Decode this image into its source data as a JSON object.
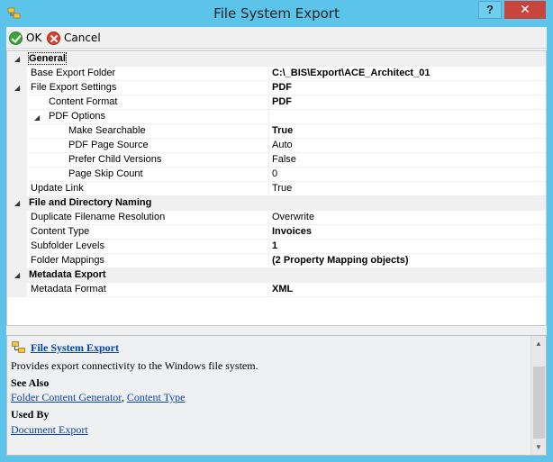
{
  "window": {
    "title": "File System Export",
    "help_button": "?",
    "close_button": "✕"
  },
  "toolbar": {
    "ok_label": "OK",
    "cancel_label": "Cancel"
  },
  "grid": {
    "general": {
      "label": "General",
      "base_export_folder": {
        "name": "Base Export Folder",
        "value": "C:\\_BIS\\Export\\ACE_Architect_01"
      },
      "file_export_settings": {
        "name": "File Export Settings",
        "value": "PDF"
      },
      "content_format": {
        "name": "Content Format",
        "value": "PDF"
      },
      "pdf_options": {
        "name": "PDF Options",
        "value": ""
      },
      "make_searchable": {
        "name": "Make Searchable",
        "value": "True"
      },
      "pdf_page_source": {
        "name": "PDF Page Source",
        "value": "Auto"
      },
      "prefer_child_versions": {
        "name": "Prefer Child Versions",
        "value": "False"
      },
      "page_skip_count": {
        "name": "Page Skip Count",
        "value": "0"
      },
      "update_link": {
        "name": "Update Link",
        "value": "True"
      }
    },
    "naming": {
      "label": "File and Directory Naming",
      "duplicate_resolution": {
        "name": "Duplicate Filename Resolution",
        "value": "Overwrite"
      },
      "content_type": {
        "name": "Content Type",
        "value": "Invoices"
      },
      "subfolder_levels": {
        "name": "Subfolder Levels",
        "value": "1"
      },
      "folder_mappings": {
        "name": "Folder Mappings",
        "value": "(2 Property Mapping objects)"
      }
    },
    "metadata": {
      "label": "Metadata Export",
      "metadata_format": {
        "name": "Metadata Format",
        "value": "XML"
      }
    }
  },
  "help": {
    "title": "File System Export",
    "description": "Provides export connectivity to the Windows file system.",
    "see_also_heading": "See Also",
    "see_also_links": [
      "Folder Content Generator",
      "Content Type"
    ],
    "see_also_separator": ", ",
    "used_by_heading": "Used By",
    "used_by_links": [
      "Document Export"
    ]
  },
  "colors": {
    "title_bar": "#5cc4ea",
    "close_button": "#c7453d",
    "link": "#0645ad"
  }
}
